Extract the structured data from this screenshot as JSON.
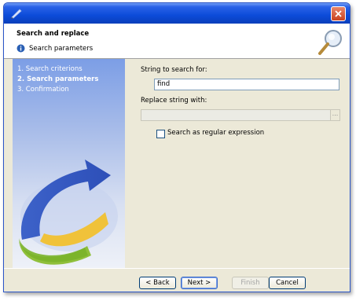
{
  "titlebar": {
    "app_icon": "pen-icon",
    "close_icon": "close-icon",
    "close_color": "#d8562f"
  },
  "header": {
    "title": "Search and replace",
    "subtitle": "Search parameters",
    "info_icon": "info-icon",
    "magnifier_icon": "magnifier-icon"
  },
  "steps": [
    {
      "label": "1. Search criterions",
      "active": false
    },
    {
      "label": "2. Search parameters",
      "active": true
    },
    {
      "label": "3. Confirmation",
      "active": false
    }
  ],
  "form": {
    "search_label": "String to search for:",
    "search_value": "find",
    "replace_label": "Replace string with:",
    "replace_value": "",
    "browse_label": "...",
    "regex_label": "Search as regular expression",
    "regex_checked": false
  },
  "buttons": {
    "back": "< Back",
    "next": "Next >",
    "finish": "Finish",
    "cancel": "Cancel"
  },
  "colors": {
    "titlebar": "#0c4bd9",
    "panel_top": "#7c9ee6",
    "window_bg": "#ece9d8"
  }
}
